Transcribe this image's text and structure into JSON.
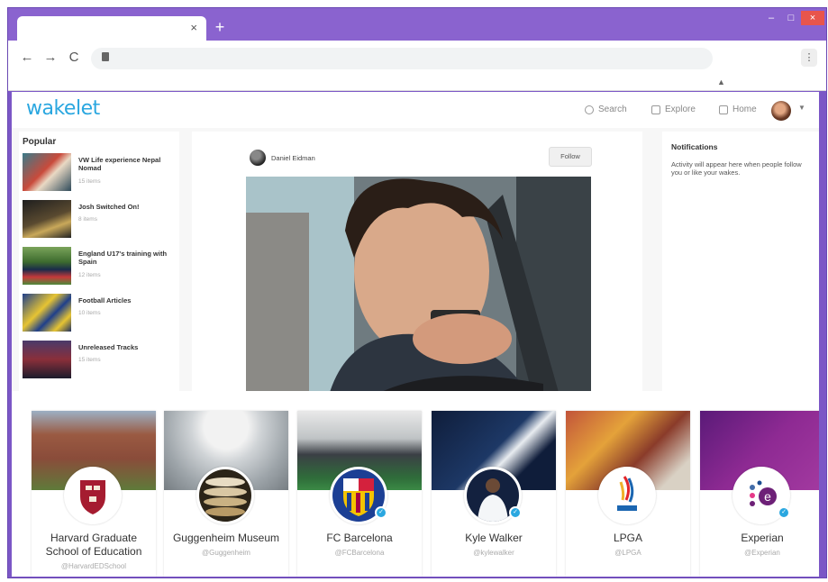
{
  "browser": {
    "tab_close": "×",
    "new_tab": "+",
    "win_min": "–",
    "win_max": "□",
    "win_close": "×",
    "back": "←",
    "forward": "→",
    "reload": "C",
    "menu": "⋮"
  },
  "header": {
    "logo": "wakelet",
    "nav": [
      {
        "label": "Search"
      },
      {
        "label": "Explore"
      },
      {
        "label": "Home"
      }
    ]
  },
  "popular": {
    "title": "Popular",
    "items": [
      {
        "title": "VW Life experience Nepal Nomad",
        "count": "15 items"
      },
      {
        "title": "Josh Switched On!",
        "count": "8 items"
      },
      {
        "title": "England U17's training with Spain",
        "count": "12 items"
      },
      {
        "title": "Football Articles",
        "count": "10 items"
      },
      {
        "title": "Unreleased Tracks",
        "count": "15 items"
      }
    ]
  },
  "post": {
    "author": "Daniel Eidman",
    "follow": "Follow"
  },
  "notifications": {
    "title": "Notifications",
    "text": "Activity will appear here when people follow you or like your wakes."
  },
  "cards": [
    {
      "name": "Harvard Graduate School of Education",
      "handle": "@HarvardEDSchool",
      "verified": false
    },
    {
      "name": "Guggenheim Museum",
      "handle": "@Guggenheim",
      "verified": false
    },
    {
      "name": "FC Barcelona",
      "handle": "@FCBarcelona",
      "verified": true
    },
    {
      "name": "Kyle Walker",
      "handle": "@kylewalker",
      "verified": true
    },
    {
      "name": "LPGA",
      "handle": "@LPGA",
      "verified": false
    },
    {
      "name": "Experian",
      "handle": "@Experian",
      "verified": true
    }
  ],
  "colors": {
    "browser_frame": "#7b57c6",
    "brand": "#2aa7e0",
    "verified": "#2aa7e0"
  }
}
